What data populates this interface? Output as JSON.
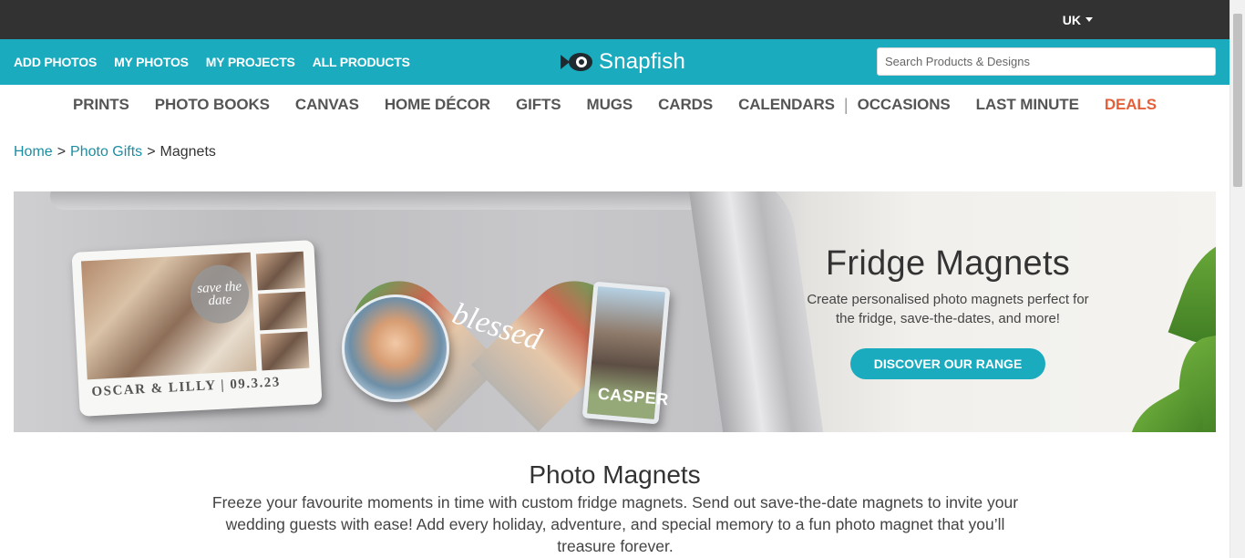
{
  "topbar": {
    "region": "UK"
  },
  "header": {
    "nav": [
      "ADD PHOTOS",
      "MY PHOTOS",
      "MY PROJECTS",
      "ALL PRODUCTS"
    ],
    "logo_text": "Snapfish",
    "search_placeholder": "Search Products & Designs"
  },
  "categories": [
    "PRINTS",
    "PHOTO BOOKS",
    "CANVAS",
    "HOME DÉCOR",
    "GIFTS",
    "MUGS",
    "CARDS",
    "CALENDARS",
    "OCCASIONS",
    "LAST MINUTE",
    "DEALS"
  ],
  "category_separator": "|",
  "breadcrumb": {
    "home": "Home",
    "sep1": ">",
    "gifts": "Photo Gifts",
    "sep2": ">",
    "current": "Magnets"
  },
  "banner": {
    "title": "Fridge Magnets",
    "subtitle": "Create personalised photo magnets perfect for the fridge, save-the-dates, and more!",
    "cta": "DISCOVER OUR RANGE",
    "card_text": "OSCAR & LILLY | 09.3.23",
    "save_date": "save the date",
    "heart_text": "blessed",
    "acrylic_text": "CASPER"
  },
  "intro": {
    "title": "Photo Magnets",
    "text": "Freeze your favourite moments in time with custom fridge magnets. Send out save-the-date magnets to invite your wedding guests with ease! Add every holiday, adventure, and special memory to a fun photo magnet that you’ll treasure forever."
  },
  "colors": {
    "topbar": "#323232",
    "brand_teal": "#1aabbf",
    "deals": "#e4603a",
    "link": "#1a8fa3"
  }
}
